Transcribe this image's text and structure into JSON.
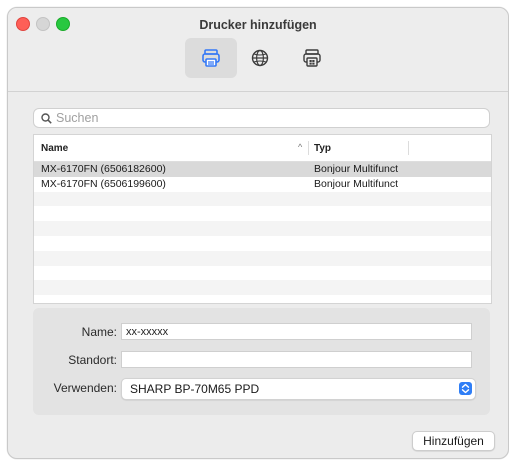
{
  "window": {
    "title": "Drucker hinzufügen"
  },
  "toolbar": {
    "items": [
      {
        "icon": "default-printer-icon",
        "active": true
      },
      {
        "icon": "ip-globe-icon",
        "active": false
      },
      {
        "icon": "windows-printer-icon",
        "active": false
      }
    ]
  },
  "search": {
    "placeholder": "Suchen",
    "value": ""
  },
  "table": {
    "headers": {
      "name": "Name",
      "sort_indicator": "^",
      "type": "Typ"
    },
    "rows": [
      {
        "name": "MX-6170FN (6506182600)",
        "type": "Bonjour Multifunct",
        "selected": true
      },
      {
        "name": "MX-6170FN (6506199600)",
        "type": "Bonjour Multifunct",
        "selected": false
      }
    ]
  },
  "form": {
    "name_label": "Name:",
    "name_value": "xx-xxxxx",
    "location_label": "Standort:",
    "location_value": "",
    "use_label": "Verwenden:",
    "use_value": "SHARP BP-70M65 PPD"
  },
  "buttons": {
    "add": "Hinzufügen"
  },
  "colors": {
    "accent": "#2f7ef6",
    "close": "#fe5f57",
    "maximize": "#28c840",
    "selection": "#d9d9d9"
  }
}
